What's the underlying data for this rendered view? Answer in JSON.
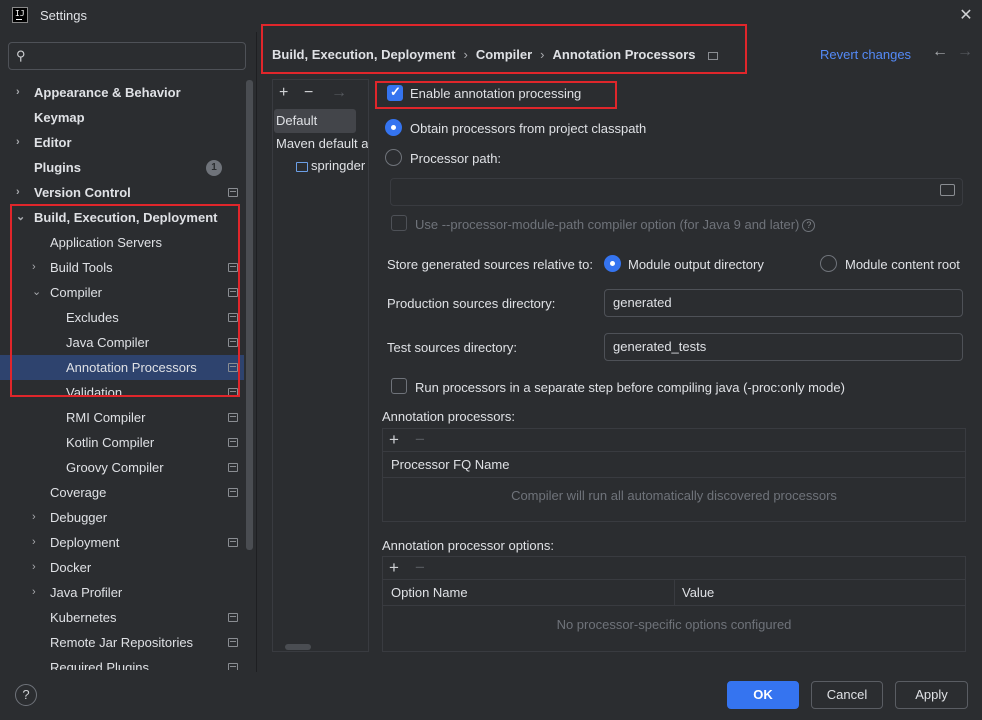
{
  "window": {
    "title": "Settings",
    "close_glyph": "✕"
  },
  "search": {
    "placeholder": "",
    "icon": "search-icon"
  },
  "tree": [
    {
      "label": "Appearance & Behavior",
      "bold": true,
      "expander": "›",
      "project": false
    },
    {
      "label": "Keymap",
      "bold": true,
      "expander": "",
      "project": false
    },
    {
      "label": "Editor",
      "bold": true,
      "expander": "›",
      "project": false
    },
    {
      "label": "Plugins",
      "bold": true,
      "expander": "",
      "badge": "1"
    },
    {
      "label": "Version Control",
      "bold": true,
      "expander": "›",
      "project": true
    },
    {
      "label": "Build, Execution, Deployment",
      "bold": true,
      "expander": "⌄",
      "project": false
    },
    {
      "label": "Application Servers",
      "expander": "",
      "project": false
    },
    {
      "label": "Build Tools",
      "expander": "›",
      "project": true
    },
    {
      "label": "Compiler",
      "expander": "⌄",
      "project": true
    },
    {
      "label": "Excludes",
      "expander": "",
      "project": true
    },
    {
      "label": "Java Compiler",
      "expander": "",
      "project": true
    },
    {
      "label": "Annotation Processors",
      "expander": "",
      "project": true,
      "selected": true
    },
    {
      "label": "Validation",
      "expander": "",
      "project": true
    },
    {
      "label": "RMI Compiler",
      "expander": "",
      "project": true
    },
    {
      "label": "Kotlin Compiler",
      "expander": "",
      "project": true
    },
    {
      "label": "Groovy Compiler",
      "expander": "",
      "project": true
    },
    {
      "label": "Coverage",
      "expander": "",
      "project": true
    },
    {
      "label": "Debugger",
      "expander": "›",
      "project": false
    },
    {
      "label": "Deployment",
      "expander": "›",
      "project": true
    },
    {
      "label": "Docker",
      "expander": "›",
      "project": false
    },
    {
      "label": "Java Profiler",
      "expander": "›",
      "project": false
    },
    {
      "label": "Kubernetes",
      "expander": "",
      "project": true
    },
    {
      "label": "Remote Jar Repositories",
      "expander": "",
      "project": true
    },
    {
      "label": "Required Plugins",
      "expander": "",
      "project": true
    }
  ],
  "breadcrumb": {
    "items": [
      "Build, Execution, Deployment",
      "Compiler",
      "Annotation Processors"
    ],
    "sep": "›"
  },
  "header": {
    "revert": "Revert changes",
    "back": "←",
    "forward": "→"
  },
  "profiles": {
    "toolbar": {
      "add": "+",
      "remove": "−",
      "move": "→"
    },
    "items": [
      "Default",
      "Maven default a",
      "springder"
    ]
  },
  "options": {
    "enable_annotation": "Enable annotation processing",
    "obtain_classpath": "Obtain processors from project classpath",
    "processor_path": "Processor path:",
    "processor_path_value": "",
    "module_path_option": "Use --processor-module-path compiler option (for Java 9 and later)",
    "store_relative": "Store generated sources relative to:",
    "module_output": "Module output directory",
    "module_content": "Module content root",
    "production_dir_label": "Production sources directory:",
    "production_dir_value": "generated",
    "test_dir_label": "Test sources directory:",
    "test_dir_value": "generated_tests",
    "separate_step": "Run processors in a separate step before compiling java (-proc:only mode)"
  },
  "processors_table": {
    "title": "Annotation processors:",
    "add": "+",
    "remove": "−",
    "header": "Processor FQ Name",
    "empty": "Compiler will run all automatically discovered processors"
  },
  "options_table": {
    "title": "Annotation processor options:",
    "add": "+",
    "remove": "−",
    "col_name": "Option Name",
    "col_value": "Value",
    "empty": "No processor-specific options configured"
  },
  "footer": {
    "help": "?",
    "ok": "OK",
    "cancel": "Cancel",
    "apply": "Apply"
  },
  "colors": {
    "accent": "#3574f0",
    "link": "#548af7",
    "highlight_box": "#e0262b",
    "background": "#2b2d30"
  }
}
